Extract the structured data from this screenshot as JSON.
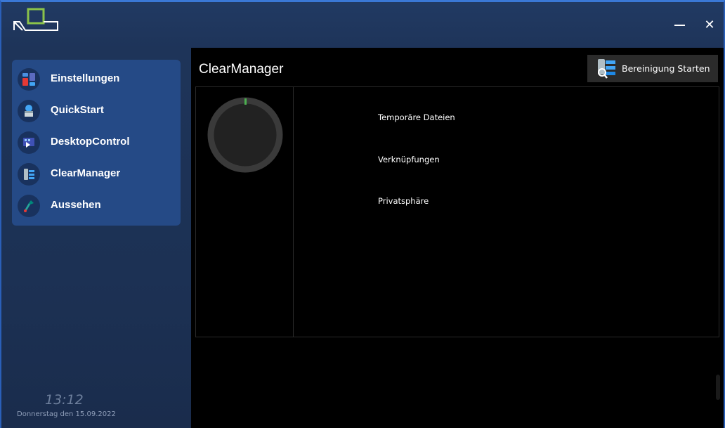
{
  "window": {
    "minimize_icon": "minimize-icon",
    "close_icon": "close-icon",
    "close_glyph": "✕",
    "logo_icon": "app-logo-icon"
  },
  "sidebar": {
    "items": [
      {
        "label": "Einstellungen",
        "icon": "settings-icon"
      },
      {
        "label": "QuickStart",
        "icon": "quickstart-icon"
      },
      {
        "label": "DesktopControl",
        "icon": "desktop-control-icon"
      },
      {
        "label": "ClearManager",
        "icon": "clear-manager-icon"
      },
      {
        "label": "Aussehen",
        "icon": "appearance-icon"
      }
    ],
    "clock": {
      "time": "13:12",
      "date": "Donnerstag den 15.09.2022"
    }
  },
  "main": {
    "title": "ClearManager",
    "start_button": {
      "label": "Bereinigung Starten",
      "icon": "cleanup-start-icon"
    },
    "categories": [
      {
        "label": "Temporäre Dateien"
      },
      {
        "label": "Verknüpfungen"
      },
      {
        "label": "Privatsphäre"
      }
    ],
    "gauge": {
      "progress": 0.01
    }
  },
  "colors": {
    "accent_green": "#4caf50",
    "sidebar_card": "#254a86",
    "titlebar": "#1e3459"
  }
}
